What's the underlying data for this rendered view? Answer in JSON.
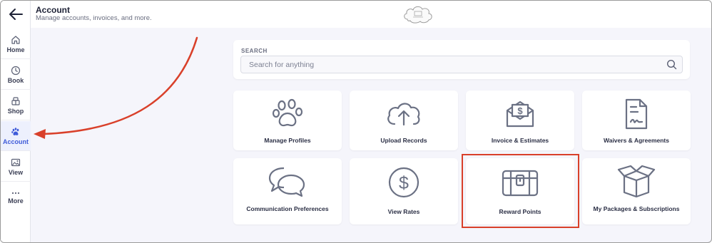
{
  "header": {
    "title": "Account",
    "subtitle": "Manage accounts, invoices, and more."
  },
  "sidebar": {
    "items": [
      {
        "label": "Home",
        "icon": "home-icon"
      },
      {
        "label": "Book",
        "icon": "clock-icon"
      },
      {
        "label": "Shop",
        "icon": "shop-icon"
      },
      {
        "label": "Account",
        "icon": "paw-icon",
        "active": true
      },
      {
        "label": "View",
        "icon": "image-icon"
      },
      {
        "label": "More",
        "icon": "more-dots-icon"
      }
    ]
  },
  "search": {
    "label": "SEARCH",
    "placeholder": "Search for anything"
  },
  "tiles": [
    {
      "label": "Manage Profiles",
      "icon": "paw-icon"
    },
    {
      "label": "Upload Records",
      "icon": "cloud-upload-icon"
    },
    {
      "label": "Invoice & Estimates",
      "icon": "invoice-envelope-icon"
    },
    {
      "label": "Waivers & Agreements",
      "icon": "signed-document-icon"
    },
    {
      "label": "Communication Preferences",
      "icon": "chat-bubbles-icon"
    },
    {
      "label": "View Rates",
      "icon": "dollar-circle-icon"
    },
    {
      "label": "Reward Points",
      "icon": "treasure-chest-icon"
    },
    {
      "label": "My Packages & Subscriptions",
      "icon": "open-box-icon"
    }
  ],
  "colors": {
    "accent": "#3f5bd9",
    "annotation": "#d9402a",
    "icon": "#6b7184"
  }
}
